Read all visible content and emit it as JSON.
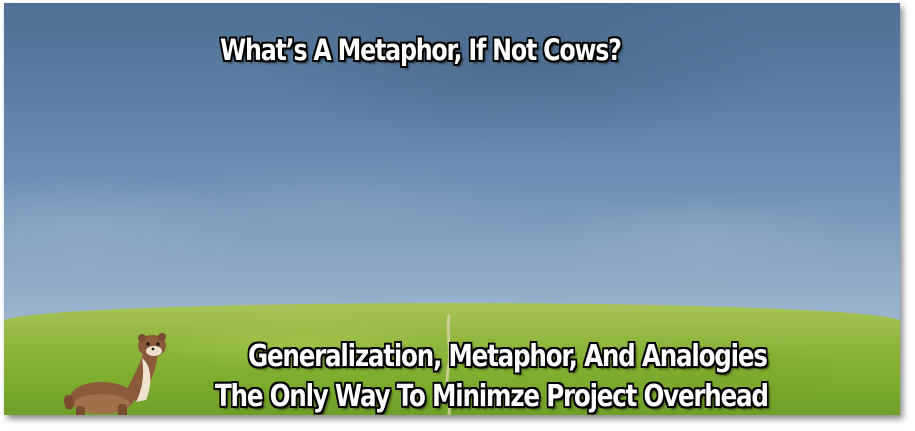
{
  "title": "What’s A Metaphor, If Not Cows?",
  "caption": {
    "line1": "Generalization, Metaphor, And Analogies",
    "line2": "The Only Way To Minimze Project Overhead"
  },
  "colors": {
    "sky_top": "#4e7093",
    "sky_bottom": "#9fb7cf",
    "grass": "#7fae2f",
    "text": "#ffffff",
    "outline": "#000000"
  },
  "icons": {
    "animal": "weasel-icon"
  }
}
